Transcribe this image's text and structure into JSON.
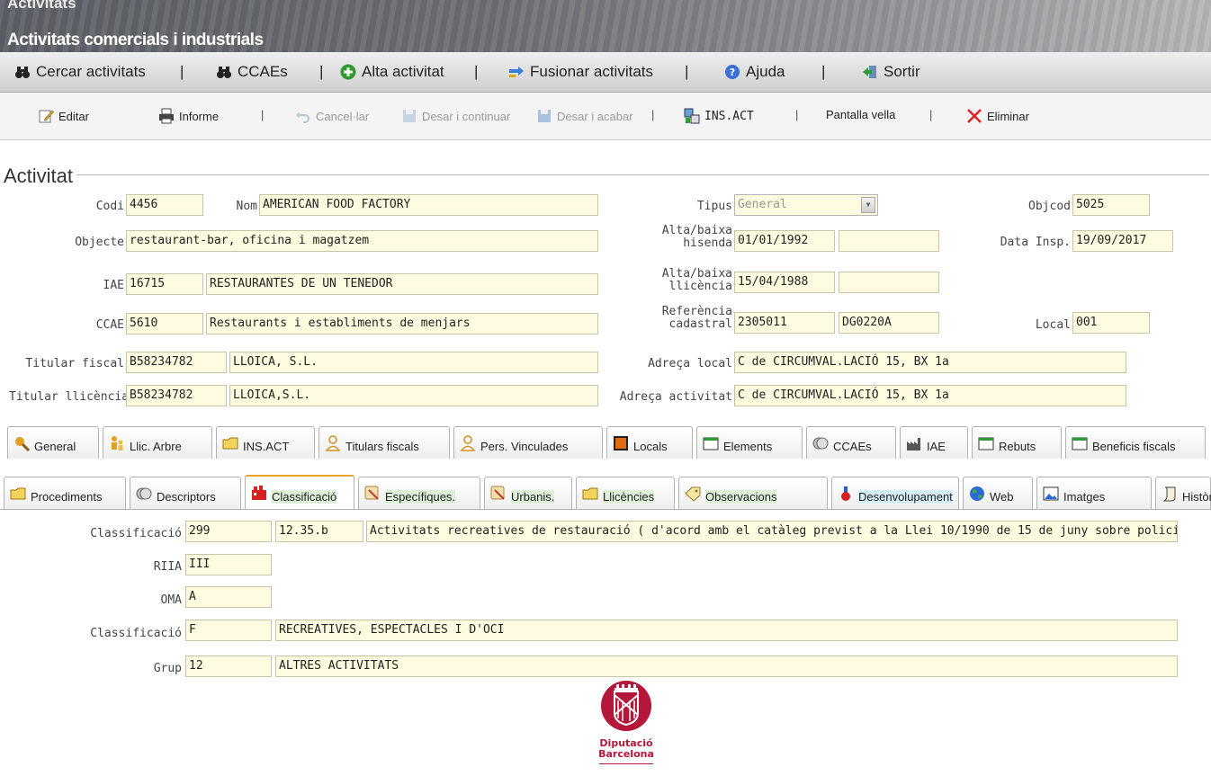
{
  "header": {
    "app": "Activitats",
    "title": "Activitats comercials i industrials"
  },
  "menu": [
    {
      "label": "Cercar activitats",
      "icon": "binoculars-icon"
    },
    {
      "label": "CCAEs",
      "icon": "binoculars-icon"
    },
    {
      "label": "Alta activitat",
      "icon": "add-icon"
    },
    {
      "label": "Fusionar activitats",
      "icon": "merge-icon"
    },
    {
      "label": "Ajuda",
      "icon": "help-icon"
    },
    {
      "label": "Sortir",
      "icon": "exit-icon"
    }
  ],
  "menu_separator": "|",
  "toolbar": {
    "edit": "Editar",
    "report": "Informe",
    "cancel": "Cancel·lar",
    "save_continue": "Desar i continuar",
    "save_finish": "Desar i acabar",
    "insact": "INS.ACT",
    "old_screen": "Pantalla vella",
    "delete": "Eliminar",
    "sep": "|"
  },
  "section": {
    "legend": "Activitat"
  },
  "form": {
    "codi_label": "Codi",
    "codi": "4456",
    "nom_label": "Nom",
    "nom": "AMERICAN FOOD FACTORY",
    "tipus_label": "Tipus",
    "tipus": "General",
    "objcod_label": "Objcod",
    "objcod": "5025",
    "objecte_label": "Objecte",
    "objecte": "restaurant-bar, oficina i magatzem",
    "alta_hisenda_label1": "Alta/baixa",
    "alta_hisenda_label2": "hisenda",
    "alta_hisenda": "01/01/1992",
    "baixa_hisenda": "",
    "data_insp_label": "Data Insp.",
    "data_insp": "19/09/2017",
    "iae_label": "IAE",
    "iae_code": "16715",
    "iae_desc": "RESTAURANTES DE UN TENEDOR",
    "alta_llicencia_label1": "Alta/baixa",
    "alta_llicencia_label2": "llicència",
    "alta_llicencia": "15/04/1988",
    "baixa_llicencia": "",
    "ccae_label": "CCAE",
    "ccae_code": "5610",
    "ccae_desc": "Restaurants i establiments de menjars",
    "ref_label1": "Referència",
    "ref_label2": "cadastral",
    "ref1": "2305011",
    "ref2": "DG0220A",
    "local_label": "Local",
    "local": "001",
    "titular_fiscal_label": "Titular fiscal",
    "titular_fiscal_nif": "B58234782",
    "titular_fiscal_name": "LLOICA, S.L.",
    "adreca_local_label": "Adreça local",
    "adreca_local": "C de CIRCUMVAL.LACIÓ 15, BX 1a",
    "titular_llicencia_label": "Titular llicència",
    "titular_llicencia_nif": "B58234782",
    "titular_llicencia_name": "LLOICA,S.L.",
    "adreca_activitat_label": "Adreça activitat",
    "adreca_activitat": "C de CIRCUMVAL.LACIÓ 15, BX 1a"
  },
  "tabs_row1": [
    "General",
    "Llic. Arbre",
    "INS.ACT",
    "Titulars fiscals",
    "Pers. Vinculades",
    "Locals",
    "Elements",
    "CCAEs",
    "IAE",
    "Rebuts",
    "Beneficis fiscals"
  ],
  "tabs_row2": [
    "Procediments",
    "Descriptors",
    "Classificació",
    "Específiques.",
    "Urbanis.",
    "Llicències",
    "Observacions",
    "Desenvolupament",
    "Web",
    "Imatges",
    "Històric"
  ],
  "classification": {
    "c1_label": "Classificació",
    "c1_code": "299",
    "c1_num": "12.35.b",
    "c1_desc": "Activitats recreatives de restauració ( d'acord amb el catàleg previst a la Llei 10/1990 de 15 de juny sobre policia d'especta",
    "riia_label": "RIIA",
    "riia": "III",
    "oma_label": "OMA",
    "oma": "A",
    "c2_label": "Classificació",
    "c2_code": "F",
    "c2_desc": "RECREATIVES, ESPECTACLES I D'OCI",
    "grup_label": "Grup",
    "grup_code": "12",
    "grup_desc": "ALTRES ACTIVITATS"
  },
  "logo": {
    "line1": "Diputació",
    "line2": "Barcelona"
  },
  "colors": {
    "field_bg": "#fffbe0",
    "logo_red": "#b5173a",
    "active_tab_accent": "#e8a42c"
  }
}
